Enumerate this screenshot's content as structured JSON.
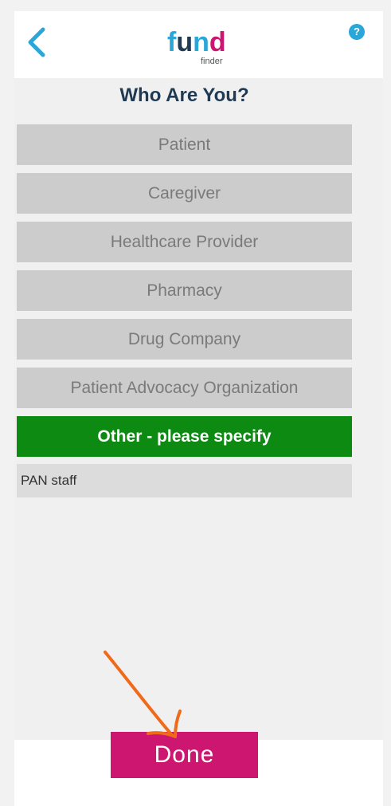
{
  "header": {
    "logo_main": "fund",
    "logo_sub": "finder",
    "help_label": "?"
  },
  "page": {
    "title": "Who Are You?"
  },
  "options": [
    {
      "label": "Patient",
      "selected": false
    },
    {
      "label": "Caregiver",
      "selected": false
    },
    {
      "label": "Healthcare Provider",
      "selected": false
    },
    {
      "label": "Pharmacy",
      "selected": false
    },
    {
      "label": "Drug Company",
      "selected": false
    },
    {
      "label": "Patient Advocacy Organization",
      "selected": false
    },
    {
      "label": "Other - please specify",
      "selected": true
    }
  ],
  "other_input": {
    "value": "PAN staff"
  },
  "footer": {
    "done_label": "Done"
  },
  "colors": {
    "accent_blue": "#2aa7d8",
    "title_navy": "#1f3a52",
    "selected_green": "#0c8a12",
    "done_magenta": "#cc1670",
    "annotation_orange": "#f06a1a"
  },
  "icons": {
    "back": "chevron-left-icon",
    "help": "question-circle-icon",
    "annotation": "hand-drawn-arrow-icon"
  }
}
